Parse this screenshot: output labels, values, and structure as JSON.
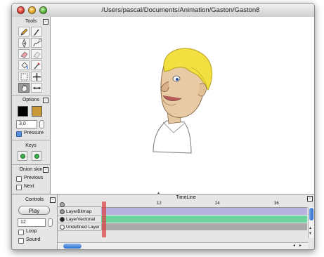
{
  "window": {
    "title": "/Users/pascal/Documents/Animation/Gaston/Gaston8"
  },
  "tools_panel": {
    "title": "Tools",
    "tools": [
      {
        "name": "pencil-icon"
      },
      {
        "name": "brush-icon"
      },
      {
        "name": "pen-icon"
      },
      {
        "name": "curve-icon"
      },
      {
        "name": "eraser-icon"
      },
      {
        "name": "smudge-icon"
      },
      {
        "name": "paint-bucket-icon"
      },
      {
        "name": "eyedropper-icon"
      },
      {
        "name": "select-icon"
      },
      {
        "name": "move-icon"
      },
      {
        "name": "hand-icon"
      },
      {
        "name": "resize-icon"
      }
    ],
    "selected_tool": "hand-icon"
  },
  "options_panel": {
    "title": "Options",
    "stroke_color": "#000000",
    "fill_color": "#c89a3a",
    "size_value": "3,0",
    "pressure_label": "Pressure",
    "pressure_checked": true
  },
  "keys_panel": {
    "title": "Keys"
  },
  "onion_panel": {
    "title": "Onion skin",
    "previous_label": "Previous",
    "next_label": "Next"
  },
  "controls_panel": {
    "title": "Controls",
    "play_label": "Play",
    "fps_value": "12",
    "loop_label": "Loop",
    "sound_label": "Sound"
  },
  "timeline": {
    "title": "TimeLine",
    "ruler_labels": [
      "12",
      "24",
      "36"
    ],
    "layers": [
      {
        "name": "LayerBitmap",
        "color": "#b7b2e0",
        "dot": "#9a9a9a"
      },
      {
        "name": "LayerVectorial",
        "color": "#6ed2a0",
        "dot": "#222222"
      },
      {
        "name": "Undefined Layer",
        "color": "#aaaaaa",
        "dot": "#ffffff"
      }
    ]
  }
}
